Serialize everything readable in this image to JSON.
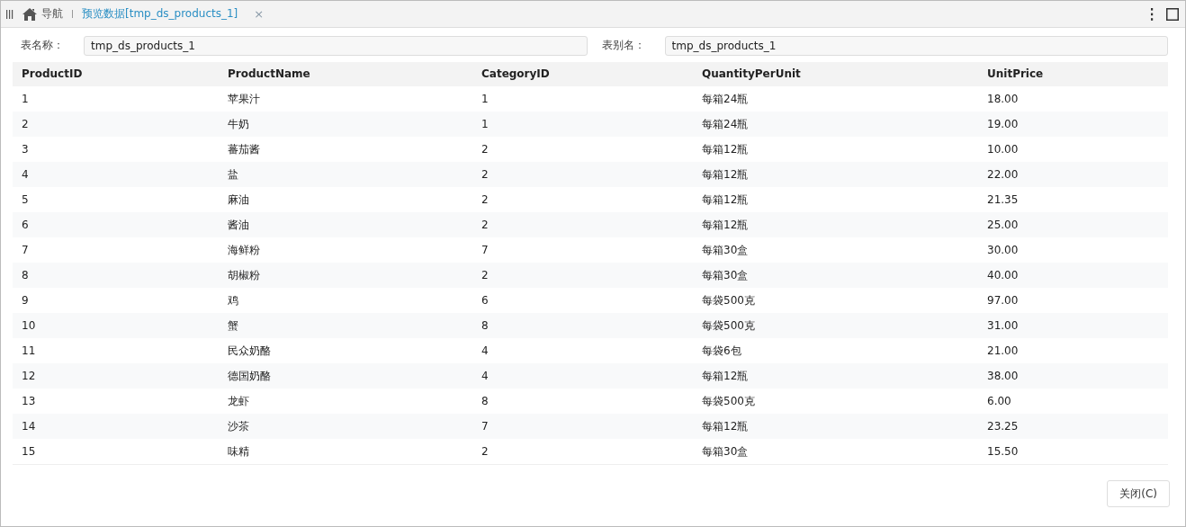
{
  "tabs": [
    {
      "label": "导航",
      "kind": "home",
      "selected": false
    },
    {
      "label": "预览数据[tmp_ds_products_1]",
      "kind": "doc",
      "selected": true,
      "close": "×"
    }
  ],
  "fields": [
    {
      "label": "表名称：",
      "value": "tmp_ds_products_1"
    },
    {
      "label": "表别名：",
      "value": "tmp_ds_products_1"
    }
  ],
  "table": {
    "columns": [
      "ProductID",
      "ProductName",
      "CategoryID",
      "QuantityPerUnit",
      "UnitPrice"
    ],
    "rows": [
      [
        "1",
        "苹果汁",
        "1",
        "每箱24瓶",
        "18.00"
      ],
      [
        "2",
        "牛奶",
        "1",
        "每箱24瓶",
        "19.00"
      ],
      [
        "3",
        "蕃茄酱",
        "2",
        "每箱12瓶",
        "10.00"
      ],
      [
        "4",
        "盐",
        "2",
        "每箱12瓶",
        "22.00"
      ],
      [
        "5",
        "麻油",
        "2",
        "每箱12瓶",
        "21.35"
      ],
      [
        "6",
        "酱油",
        "2",
        "每箱12瓶",
        "25.00"
      ],
      [
        "7",
        "海鲜粉",
        "7",
        "每箱30盒",
        "30.00"
      ],
      [
        "8",
        "胡椒粉",
        "2",
        "每箱30盒",
        "40.00"
      ],
      [
        "9",
        "鸡",
        "6",
        "每袋500克",
        "97.00"
      ],
      [
        "10",
        "蟹",
        "8",
        "每袋500克",
        "31.00"
      ],
      [
        "11",
        "民众奶酪",
        "4",
        "每袋6包",
        "21.00"
      ],
      [
        "12",
        "德国奶酪",
        "4",
        "每箱12瓶",
        "38.00"
      ],
      [
        "13",
        "龙虾",
        "8",
        "每袋500克",
        "6.00"
      ],
      [
        "14",
        "沙茶",
        "7",
        "每箱12瓶",
        "23.25"
      ],
      [
        "15",
        "味精",
        "2",
        "每箱30盒",
        "15.50"
      ]
    ]
  },
  "close_button": "关闭(C)"
}
